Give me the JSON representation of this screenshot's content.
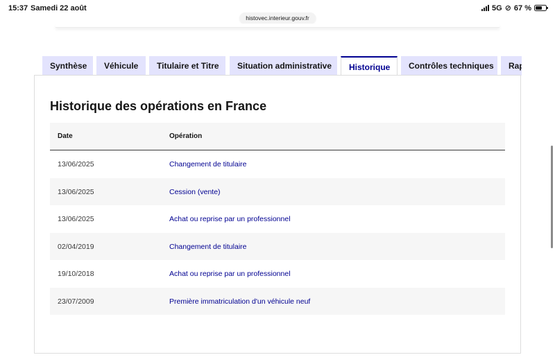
{
  "status_bar": {
    "time": "15:37",
    "date": "Samedi 22 août",
    "network": "5G",
    "battery": "67 %",
    "battery_level": 0.67
  },
  "browser": {
    "url": "histovec.interieur.gouv.fr"
  },
  "tabs": [
    {
      "label": "Synthèse",
      "active": false
    },
    {
      "label": "Véhicule",
      "active": false
    },
    {
      "label": "Titulaire et Titre",
      "active": false
    },
    {
      "label": "Situation administrative",
      "active": false
    },
    {
      "label": "Historique",
      "active": true
    },
    {
      "label": "Contrôles techniques",
      "active": false
    },
    {
      "label": "Rap",
      "active": false
    }
  ],
  "page": {
    "title": "Historique des opérations en France"
  },
  "table": {
    "headers": {
      "date": "Date",
      "operation": "Opération"
    },
    "rows": [
      {
        "date": "13/06/2025",
        "operation": "Changement de titulaire"
      },
      {
        "date": "13/06/2025",
        "operation": "Cession (vente)"
      },
      {
        "date": "13/06/2025",
        "operation": "Achat ou reprise par un professionnel"
      },
      {
        "date": "02/04/2019",
        "operation": "Changement de titulaire"
      },
      {
        "date": "19/10/2018",
        "operation": "Achat ou reprise par un professionnel"
      },
      {
        "date": "23/07/2009",
        "operation": "Première immatriculation d'un véhicule neuf"
      }
    ]
  },
  "colors": {
    "accent": "#000091",
    "tab_bg": "#e3e3fd",
    "row_alt": "#f6f6f6"
  },
  "icons": [
    "signal-icon",
    "rotation-lock-icon",
    "battery-icon"
  ]
}
